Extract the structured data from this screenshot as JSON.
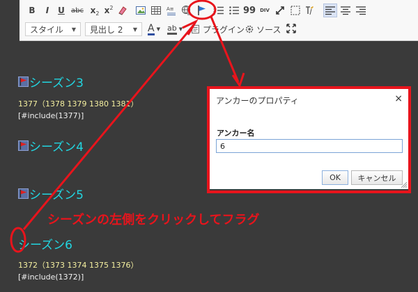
{
  "toolbar": {
    "row1": {
      "bold": "B",
      "italic": "I",
      "underline": "U",
      "strike": "abc",
      "subscript": "x",
      "superscript": "x",
      "blockquote": "99",
      "div": "DIV"
    },
    "row2": {
      "style_combo": "スタイル",
      "format_combo": "見出し 2",
      "text_color": "A",
      "bg_color": "ab",
      "plugin_label": "プラグイン",
      "source_label": "ソース"
    }
  },
  "content": {
    "heading3": "シーズン3",
    "line3": "1377（1378 1379 1380 1381）",
    "include3": "[#include(1377)]",
    "heading4": "シーズン4",
    "heading5": "シーズン5",
    "heading6": "シーズン6",
    "line6": "1372（1373 1374 1375 1376）",
    "include6": "[#include(1372)]"
  },
  "dialog": {
    "title": "アンカーのプロパティ",
    "close": "×",
    "field_label": "アンカー名",
    "field_value": "6",
    "ok": "OK",
    "cancel": "キャンセル"
  },
  "annotation": {
    "callout": "シーズンの左側をクリックしてフラグ",
    "color": "#e8141c"
  },
  "colors": {
    "heading": "#22d5e0",
    "background": "#3a3a3a",
    "highlight": "#e8141c"
  }
}
